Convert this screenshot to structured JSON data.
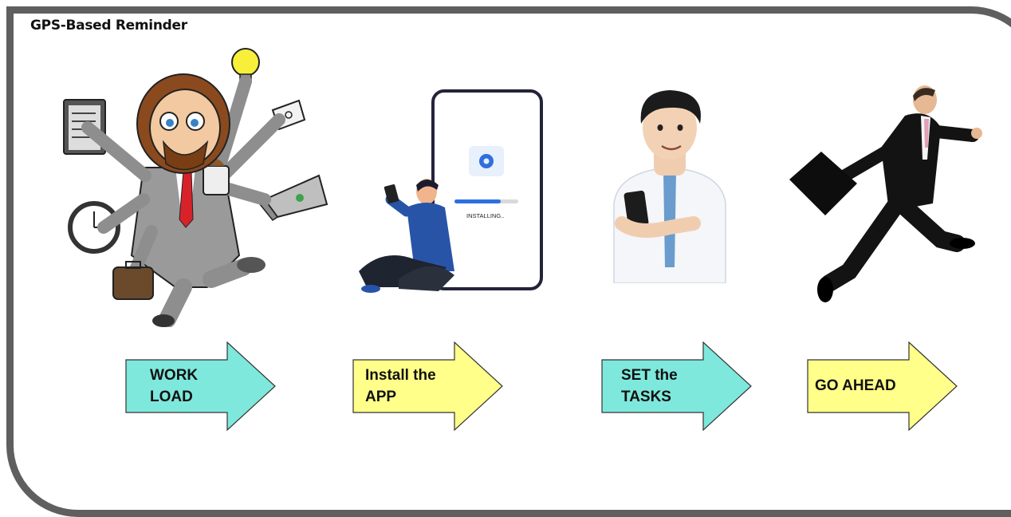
{
  "title": "GPS-Based Reminder",
  "phone_status": "INSTALLING..",
  "steps": [
    {
      "label": "WORK\nLOAD",
      "fill": "#7ee8dc"
    },
    {
      "label": "Install the\nAPP",
      "fill": "#ffff8a"
    },
    {
      "label": "SET the\nTASKS",
      "fill": "#7ee8dc"
    },
    {
      "label": "GO AHEAD",
      "fill": "#ffff8a"
    }
  ],
  "colors": {
    "frame": "#5f5f5f",
    "stroke": "#333333"
  }
}
